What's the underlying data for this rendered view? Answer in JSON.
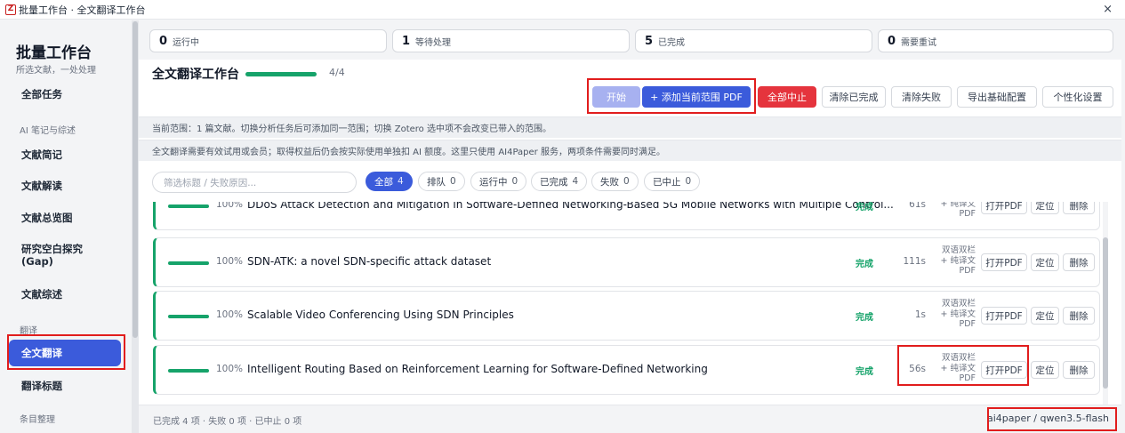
{
  "window": {
    "title": "批量工作台 · 全文翻译工作台",
    "app_icon": "Z",
    "close": "×"
  },
  "sidebar": {
    "brand": "批量工作台",
    "subtitle": "所选文献，一处处理",
    "items": {
      "all_tasks": "全部任务",
      "section_ai": "AI 笔记与综述",
      "brief": "文献简记",
      "reading": "文献解读",
      "overview": "文献总览图",
      "gap": "研究空白探究\n(Gap)",
      "review": "文献综述",
      "section_translate": "翻译",
      "full_translate": "全文翻译",
      "title_translate": "翻译标题",
      "section_items": "条目整理"
    }
  },
  "stats": [
    {
      "num": "0",
      "label": "运行中"
    },
    {
      "num": "1",
      "label": "等待处理"
    },
    {
      "num": "5",
      "label": "已完成"
    },
    {
      "num": "0",
      "label": "需要重试"
    }
  ],
  "workspace": {
    "title": "全文翻译工作台",
    "progress_fraction": 1.0,
    "progress_text": "4/4",
    "buttons": {
      "start": "开始",
      "add_pdf": "+ 添加当前范围 PDF",
      "stop_all": "全部中止",
      "clear_done": "清除已完成",
      "clear_failed": "清除失败",
      "export_config": "导出基础配置",
      "personalize": "个性化设置"
    },
    "info_scope": "当前范围：1 篇文献。切换分析任务后可添加同一范围；切换 Zotero 选中项不会改变已带入的范围。",
    "info_membership": "全文翻译需要有效试用或会员；取得权益后仍会按实际使用单独扣 AI 额度。这里只使用 AI4Paper 服务，两项条件需要同时满足。"
  },
  "filter": {
    "placeholder": "筛选标题 / 失败原因...",
    "chips": [
      {
        "label": "全部",
        "count": "4"
      },
      {
        "label": "排队",
        "count": "0"
      },
      {
        "label": "运行中",
        "count": "0"
      },
      {
        "label": "已完成",
        "count": "4"
      },
      {
        "label": "失败",
        "count": "0"
      },
      {
        "label": "已中止",
        "count": "0"
      }
    ]
  },
  "tasks": [
    {
      "percent": "100%",
      "title": "DDoS Attack Detection and Mitigation in Software-Defined Networking-Based 5G Mobile Networks with Multiple Control...",
      "status": "完成",
      "duration": "61s",
      "mode": "双语双栏\n+ 纯译文\nPDF",
      "open": "打开PDF",
      "locate": "定位",
      "delete": "删除"
    },
    {
      "percent": "100%",
      "title": "SDN-ATK: a novel SDN-specific attack dataset",
      "status": "完成",
      "duration": "111s",
      "mode": "双语双栏\n+ 纯译文\nPDF",
      "open": "打开PDF",
      "locate": "定位",
      "delete": "删除"
    },
    {
      "percent": "100%",
      "title": "Scalable Video Conferencing Using SDN Principles",
      "status": "完成",
      "duration": "1s",
      "mode": "双语双栏\n+ 纯译文\nPDF",
      "open": "打开PDF",
      "locate": "定位",
      "delete": "删除"
    },
    {
      "percent": "100%",
      "title": "Intelligent Routing Based on Reinforcement Learning for Software-Defined Networking",
      "status": "完成",
      "duration": "56s",
      "mode": "双语双栏\n+ 纯译文\nPDF",
      "open": "打开PDF",
      "locate": "定位",
      "delete": "删除"
    }
  ],
  "footer": {
    "summary": "已完成 4 项 · 失败 0 项 · 已中止 0 项",
    "model": "ai4paper / qwen3.5-flash"
  },
  "colors": {
    "accent": "#3b5bdb",
    "success": "#16a36a",
    "danger": "#e5343d",
    "highlight": "#e11d1d"
  }
}
